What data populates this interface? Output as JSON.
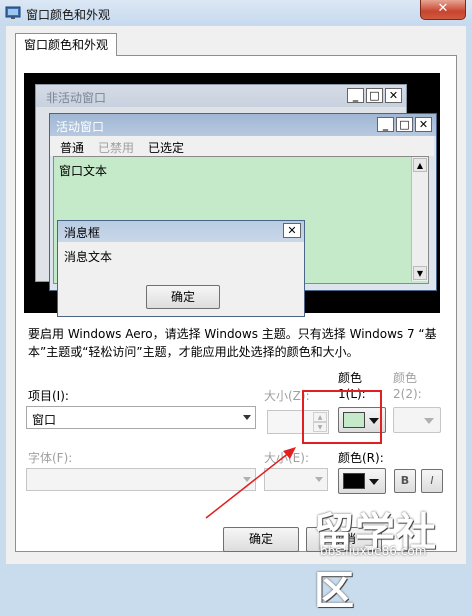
{
  "window": {
    "title": "窗口颜色和外观",
    "close": "✕"
  },
  "tab": {
    "label": "窗口颜色和外观"
  },
  "preview": {
    "inactive_title": "非活动窗口",
    "active_title": "活动窗口",
    "menu": [
      "普通",
      "已禁用",
      "已选定"
    ],
    "window_text": "窗口文本",
    "msgbox_title": "消息框",
    "msgbox_text": "消息文本",
    "msgbox_ok": "确定"
  },
  "info_text": "要启用 Windows Aero，请选择 Windows 主题。只有选择 Windows 7 “基本”主题或“轻松访问”主题，才能应用此处选择的颜色和大小。",
  "item": {
    "label": "项目(I):",
    "value": "窗口"
  },
  "size_label": "大小(Z):",
  "color1": {
    "label_top": "颜色",
    "label_bottom": "1(L):",
    "swatch": "#c5eac9"
  },
  "color2": {
    "label_top": "颜色",
    "label_bottom": "2(2):"
  },
  "font": {
    "label": "字体(F):",
    "value": ""
  },
  "font_size_label": "大小(E):",
  "font_color": {
    "label": "颜色(R):",
    "swatch": "#000000"
  },
  "bold": "B",
  "italic": "I",
  "dialog_buttons": {
    "ok": "确定",
    "cancel": "取消"
  },
  "watermark": {
    "main": "留学社区",
    "url": "bbs.liuxue86.com"
  }
}
